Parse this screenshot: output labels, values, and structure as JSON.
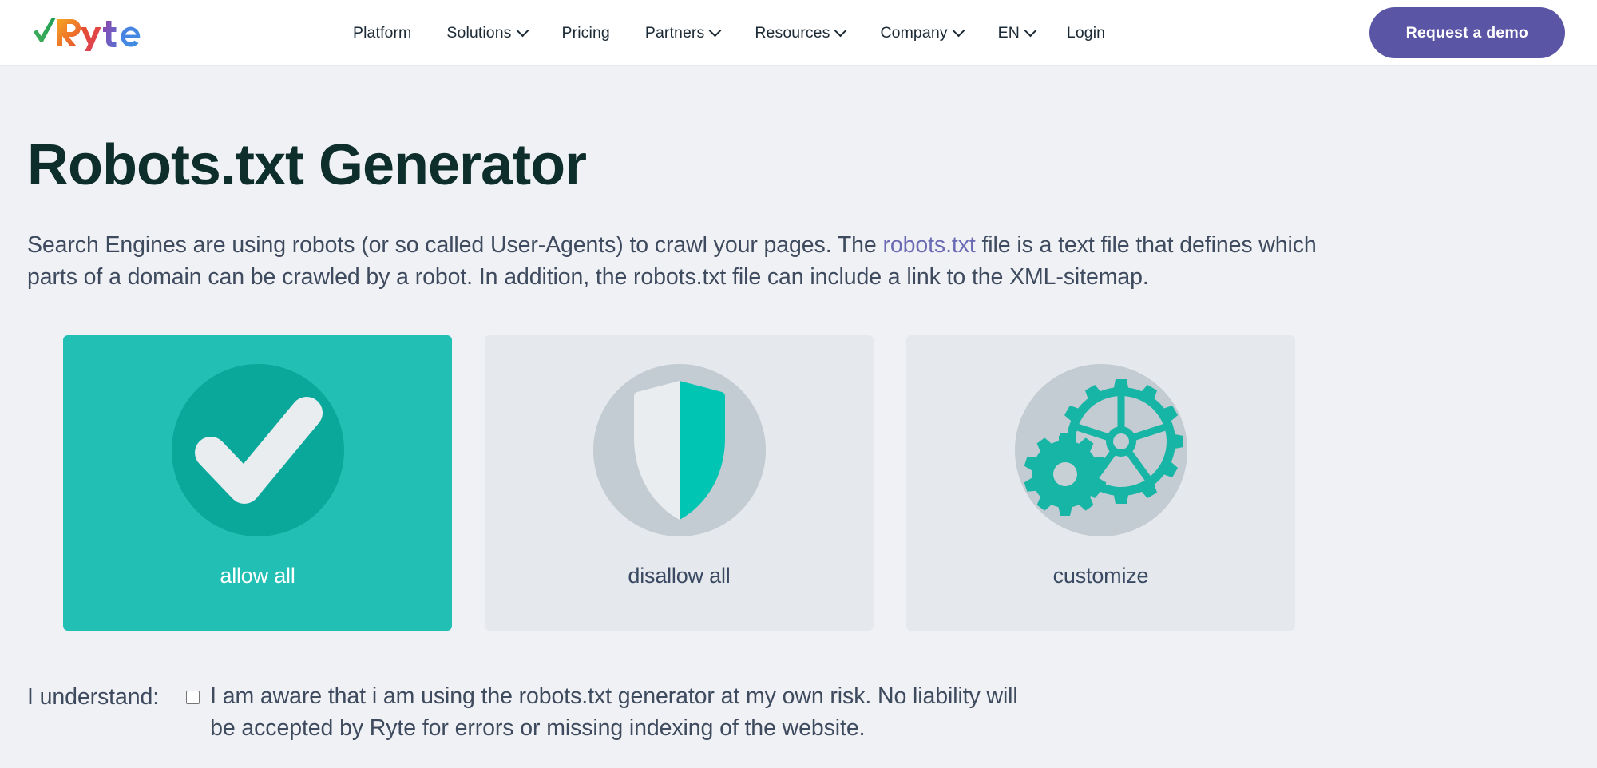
{
  "header": {
    "logo_text": "Ryte",
    "logo_icon": "check-logo-icon",
    "nav": [
      {
        "label": "Platform",
        "has_dropdown": false
      },
      {
        "label": "Solutions",
        "has_dropdown": true
      },
      {
        "label": "Pricing",
        "has_dropdown": false
      },
      {
        "label": "Partners",
        "has_dropdown": true
      },
      {
        "label": "Resources",
        "has_dropdown": true
      },
      {
        "label": "Company",
        "has_dropdown": true
      },
      {
        "label": "EN",
        "has_dropdown": true
      }
    ],
    "login_label": "Login",
    "demo_button_label": "Request a demo",
    "demo_button_color": "#5a55a5"
  },
  "main": {
    "title": "Robots.txt Generator",
    "intro": {
      "part1": "Search Engines are using robots (or so called User-Agents) to crawl your pages. The ",
      "link": "robots.txt",
      "part2": " file is a text file that defines which parts of a domain can be crawled by a robot. In addition, the robots.txt file can include a link to the XML-sitemap.",
      "link_color": "#6b6bb5"
    },
    "cards": [
      {
        "label": "allow all",
        "icon": "check-circle-icon",
        "selected": true,
        "bg": "#22bfb5"
      },
      {
        "label": "disallow all",
        "icon": "shield-icon",
        "selected": false,
        "bg": "#e5e8ec"
      },
      {
        "label": "customize",
        "icon": "gears-icon",
        "selected": false,
        "bg": "#e5e8ec"
      }
    ],
    "understand": {
      "label": "I understand:",
      "checkbox_checked": false,
      "text": "I am aware that i am using the robots.txt generator at my own risk. No liability will be accepted by Ryte for errors or missing indexing of the website."
    }
  },
  "colors": {
    "page_bg": "#f0f1f5",
    "header_bg": "#ffffff",
    "title": "#0d2e2b",
    "body_text": "#3e4a5e",
    "accent_teal": "#22bfb5",
    "accent_teal_dark": "#0aa79b",
    "card_gray": "#e5e8ec",
    "circle_gray": "#c3ccd2"
  }
}
